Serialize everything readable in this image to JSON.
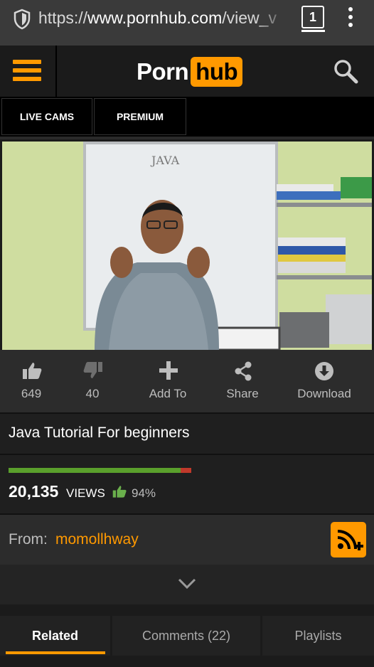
{
  "browser": {
    "url_scheme": "https://",
    "url_host": "www.pornhub.com",
    "url_path": "/view_v",
    "tab_count": "1"
  },
  "header": {
    "logo_left": "Porn",
    "logo_right": "hub",
    "brand_color": "#ff9900"
  },
  "nav": {
    "live_cams": "LIVE CAMS",
    "premium": "PREMIUM"
  },
  "video": {
    "whiteboard_text": "JAVA"
  },
  "actions": {
    "likes": "649",
    "dislikes": "40",
    "add_to": "Add To",
    "share": "Share",
    "download": "Download"
  },
  "info": {
    "title": "Java Tutorial For beginners",
    "views_count": "20,135",
    "views_label": "VIEWS",
    "rating_percent": "94%",
    "rating_fraction": 0.94,
    "from_label": "From:",
    "uploader": "momollhway"
  },
  "tabs": {
    "related": "Related",
    "comments": "Comments (22)",
    "playlists": "Playlists"
  }
}
